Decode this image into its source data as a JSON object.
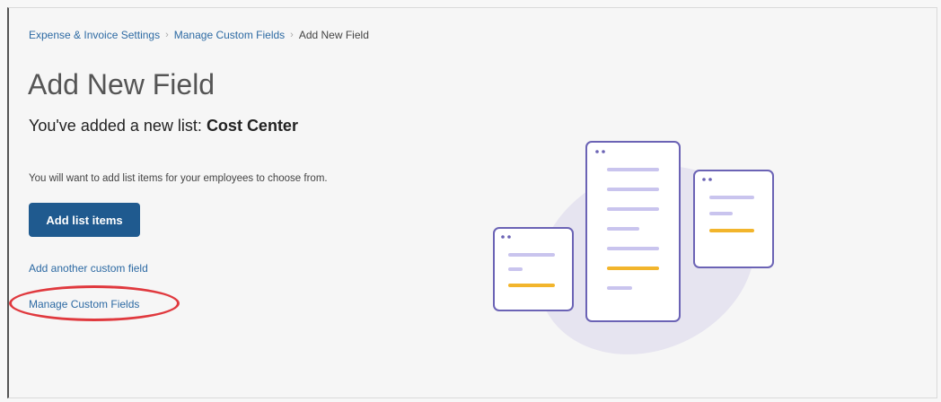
{
  "breadcrumb": {
    "items": [
      "Expense & Invoice Settings",
      "Manage Custom Fields"
    ],
    "separator": "›",
    "current": "Add New Field"
  },
  "page": {
    "title": "Add New Field",
    "subtitle_prefix": "You've added a new list:",
    "list_name": "Cost Center",
    "description": "You will want to add list items for your employees to choose from."
  },
  "actions": {
    "add_list_items": "Add list items",
    "add_another": "Add another custom field",
    "manage_custom_fields": "Manage Custom Fields"
  },
  "colors": {
    "primary": "#1f5a8f",
    "link": "#2d6aa3",
    "highlight": "#e0393e",
    "card_border": "#6b63b5",
    "card_line": "#c9c4ee",
    "card_accent": "#f2b52c",
    "blob": "#e6e4f0"
  },
  "illustration": {
    "icon": "documents-illustration"
  }
}
